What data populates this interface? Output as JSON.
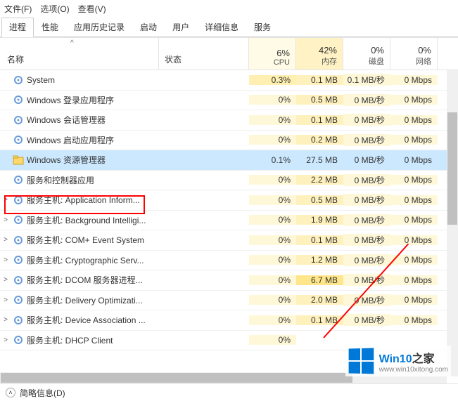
{
  "menu": {
    "file": "文件(F)",
    "options": "选项(O)",
    "view": "查看(V)"
  },
  "tabs": {
    "processes": "进程",
    "performance": "性能",
    "history": "应用历史记录",
    "startup": "启动",
    "users": "用户",
    "details": "详细信息",
    "services": "服务"
  },
  "header": {
    "name": "名称",
    "status": "状态",
    "cpu_pct": "6%",
    "cpu_lbl": "CPU",
    "mem_pct": "42%",
    "mem_lbl": "内存",
    "disk_pct": "0%",
    "disk_lbl": "磁盘",
    "net_pct": "0%",
    "net_lbl": "网络",
    "sort_indicator": "^"
  },
  "rows": [
    {
      "exp": "",
      "icon": "gear",
      "name": "System",
      "cpu": "0.3%",
      "mem": "0.1 MB",
      "disk": "0.1 MB/秒",
      "net": "0 Mbps",
      "cpuhi": true
    },
    {
      "exp": "",
      "icon": "gear",
      "name": "Windows 登录应用程序",
      "cpu": "0%",
      "mem": "0.5 MB",
      "disk": "0 MB/秒",
      "net": "0 Mbps"
    },
    {
      "exp": "",
      "icon": "gear",
      "name": "Windows 会话管理器",
      "cpu": "0%",
      "mem": "0.1 MB",
      "disk": "0 MB/秒",
      "net": "0 Mbps"
    },
    {
      "exp": "",
      "icon": "gear",
      "name": "Windows 启动应用程序",
      "cpu": "0%",
      "mem": "0.2 MB",
      "disk": "0 MB/秒",
      "net": "0 Mbps"
    },
    {
      "exp": "",
      "icon": "explorer",
      "name": "Windows 资源管理器",
      "cpu": "0.1%",
      "mem": "27.5 MB",
      "disk": "0 MB/秒",
      "net": "0 Mbps",
      "highlight": true
    },
    {
      "exp": "",
      "icon": "gear",
      "name": "服务和控制器应用",
      "cpu": "0%",
      "mem": "2.2 MB",
      "disk": "0 MB/秒",
      "net": "0 Mbps"
    },
    {
      "exp": ">",
      "icon": "gear",
      "name": "服务主机: Application Inform...",
      "cpu": "0%",
      "mem": "0.5 MB",
      "disk": "0 MB/秒",
      "net": "0 Mbps"
    },
    {
      "exp": ">",
      "icon": "gear",
      "name": "服务主机: Background Intelligi...",
      "cpu": "0%",
      "mem": "1.9 MB",
      "disk": "0 MB/秒",
      "net": "0 Mbps"
    },
    {
      "exp": ">",
      "icon": "gear",
      "name": "服务主机: COM+ Event System",
      "cpu": "0%",
      "mem": "0.1 MB",
      "disk": "0 MB/秒",
      "net": "0 Mbps"
    },
    {
      "exp": ">",
      "icon": "gear",
      "name": "服务主机: Cryptographic Serv...",
      "cpu": "0%",
      "mem": "1.2 MB",
      "disk": "0 MB/秒",
      "net": "0 Mbps"
    },
    {
      "exp": ">",
      "icon": "gear",
      "name": "服务主机: DCOM 服务器进程...",
      "cpu": "0%",
      "mem": "6.7 MB",
      "disk": "0 MB/秒",
      "net": "0 Mbps"
    },
    {
      "exp": ">",
      "icon": "gear",
      "name": "服务主机: Delivery Optimizati...",
      "cpu": "0%",
      "mem": "2.0 MB",
      "disk": "0 MB/秒",
      "net": "0 Mbps"
    },
    {
      "exp": ">",
      "icon": "gear",
      "name": "服务主机: Device Association ...",
      "cpu": "0%",
      "mem": "0.1 MB",
      "disk": "0 MB/秒",
      "net": "0 Mbps"
    },
    {
      "exp": ">",
      "icon": "gear",
      "name": "服务主机: DHCP Client",
      "cpu": "0%",
      "mem": "",
      "disk": "",
      "net": ""
    }
  ],
  "footer": {
    "label": "简略信息(D)"
  },
  "watermark": {
    "main1": "Win10",
    "main2": "之家",
    "sub": "www.win10xitong.com"
  }
}
